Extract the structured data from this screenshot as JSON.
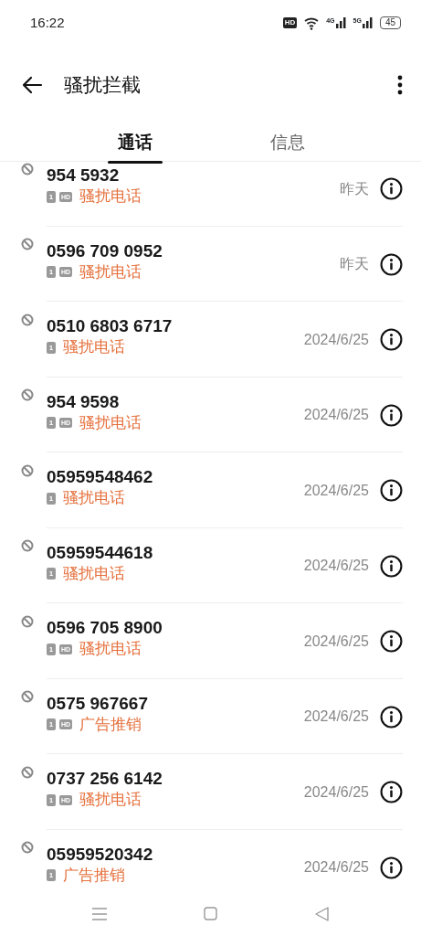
{
  "status_bar": {
    "time": "16:22",
    "hd": "HD",
    "signal_1": "4G",
    "signal_2": "5G",
    "battery": "45"
  },
  "header": {
    "title": "骚扰拦截"
  },
  "tabs": [
    {
      "label": "通话",
      "selected": true
    },
    {
      "label": "信息",
      "selected": false
    }
  ],
  "calls": [
    {
      "number": "954 5932",
      "sim": "1",
      "hd": "HD",
      "tag": "骚扰电话",
      "date": "昨天"
    },
    {
      "number": "0596 709 0952",
      "sim": "1",
      "hd": "HD",
      "tag": "骚扰电话",
      "date": "昨天"
    },
    {
      "number": "0510 6803 6717",
      "sim": "1",
      "tag": "骚扰电话",
      "date": "2024/6/25"
    },
    {
      "number": "954 9598",
      "sim": "1",
      "hd": "HD",
      "tag": "骚扰电话",
      "date": "2024/6/25"
    },
    {
      "number": "05959548462",
      "sim": "1",
      "tag": "骚扰电话",
      "date": "2024/6/25"
    },
    {
      "number": "05959544618",
      "sim": "1",
      "tag": "骚扰电话",
      "date": "2024/6/25"
    },
    {
      "number": "0596 705 8900",
      "sim": "1",
      "hd": "HD",
      "tag": "骚扰电话",
      "date": "2024/6/25"
    },
    {
      "number": "0575 967667",
      "sim": "1",
      "hd": "HD",
      "tag": "广告推销",
      "date": "2024/6/25"
    },
    {
      "number": "0737 256 6142",
      "sim": "1",
      "hd": "HD",
      "tag": "骚扰电话",
      "date": "2024/6/25"
    },
    {
      "number": "05959520342",
      "sim": "1",
      "tag": "广告推销",
      "date": "2024/6/25"
    }
  ]
}
